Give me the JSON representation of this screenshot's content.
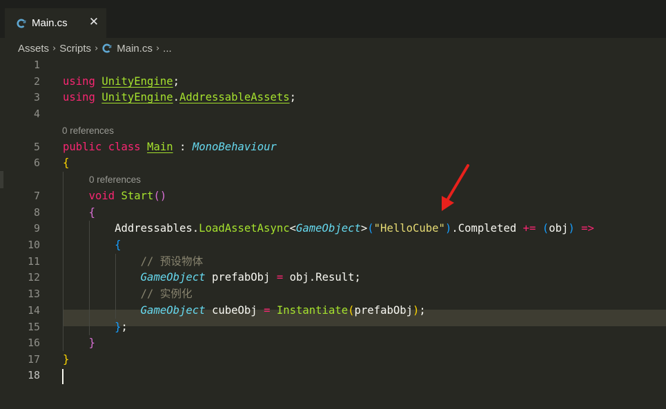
{
  "tab": {
    "label": "Main.cs",
    "icon": "csharp-icon"
  },
  "breadcrumb": {
    "items": [
      "Assets",
      "Scripts",
      "Main.cs",
      "..."
    ]
  },
  "editor": {
    "line_numbers": [
      "1",
      "2",
      "3",
      "4",
      "5",
      "6",
      "7",
      "8",
      "9",
      "10",
      "11",
      "12",
      "13",
      "14",
      "15",
      "16",
      "17",
      "18"
    ],
    "lens_class": "0 references",
    "lens_method": "0 references",
    "tokens": {
      "using": "using",
      "unity_engine": "UnityEngine",
      "dot": ".",
      "semicolon": ";",
      "addressable_assets": "AddressableAssets",
      "public": "public",
      "class": "class",
      "main": "Main",
      "colon": ":",
      "mono_behaviour": "MonoBehaviour",
      "open_brace": "{",
      "close_brace": "}",
      "void": "void",
      "start": "Start",
      "parens": "()",
      "addressables": "Addressables",
      "load_asset_async": "LoadAssetAsync",
      "lt": "<",
      "gt": ">",
      "game_object": "GameObject",
      "open_paren": "(",
      "close_paren": ")",
      "hello_cube": "\"HelloCube\"",
      "completed": "Completed",
      "plus_eq": "+=",
      "obj": "obj",
      "arrow": "=>",
      "comment_1": "// 预设物体",
      "prefab_obj": "prefabObj",
      "eq": "=",
      "result": "Result",
      "comment_2": "// 实例化",
      "cube_obj": "cubeObj",
      "instantiate": "Instantiate",
      "close_brace_semi": "};"
    }
  },
  "colors": {
    "background": "#272822",
    "keyword": "#f92672",
    "type": "#a6e22e",
    "interface": "#66d9ef",
    "string": "#e6db74",
    "comment": "#88846f",
    "annotation_arrow": "#e8211c"
  }
}
